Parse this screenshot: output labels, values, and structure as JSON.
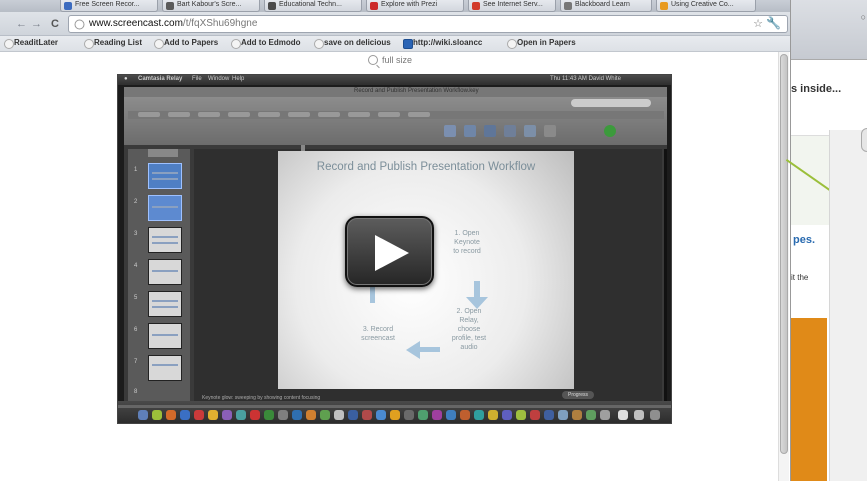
{
  "browser": {
    "tabs": [
      {
        "label": "Free Screen Recor...",
        "color": "#3c6bbf"
      },
      {
        "label": "Bart Kabour's Scre...",
        "color": "#5b5b5b"
      },
      {
        "label": "Educational Techn...",
        "color": "#4b4b4b"
      },
      {
        "label": "Explore with Prezi",
        "color": "#cc2a2a"
      },
      {
        "label": "See Internet Serv...",
        "color": "#d23b2b"
      },
      {
        "label": "Blackboard Learn",
        "color": "#777777"
      },
      {
        "label": "Using Creative Co...",
        "color": "#e89a20"
      }
    ],
    "nav": {
      "back": "←",
      "forward": "→",
      "reload": "C"
    },
    "url_host": "www.screencast.com",
    "url_path": "/t/fqXShu69hgne",
    "bookmarks": [
      {
        "label": "ReaditLater",
        "style": "circle"
      },
      {
        "label": "Reading List",
        "style": "circle"
      },
      {
        "label": "Add to Papers",
        "style": "circle"
      },
      {
        "label": "Add to Edmodo",
        "style": "circle"
      },
      {
        "label": "save on delicious",
        "style": "circle"
      },
      {
        "label": "http://wiki.sloancc",
        "style": "blue"
      },
      {
        "label": "Open in Papers",
        "style": "circle"
      }
    ]
  },
  "page": {
    "full_size_label": "full size"
  },
  "video": {
    "mac_menu": [
      "Camtasia Relay",
      "File",
      "Window",
      "Help"
    ],
    "mac_clock": "Thu 11:43 AM  David White",
    "keynote_title": "Record and Publish Presentation Workflow.key",
    "slide": {
      "title": "Record and Publish Presentation Workflow",
      "step1": "1. Open\nKeynote\nto record",
      "step2": "2. Open\nRelay,\nchoose\nprofile, test\naudio",
      "step3": "3. Record\nscreencast"
    },
    "status_text": "Keynote glow: sweeping by showing content focusing",
    "progress_label": "Progress",
    "slide_numbers": [
      "1",
      "2",
      "3",
      "4",
      "5",
      "6",
      "7",
      "8"
    ]
  },
  "right_window": {
    "text1": "s inside...",
    "text2": "pes.",
    "text3": "it the"
  },
  "colors": {
    "accent_green": "#9bbf3a",
    "accent_orange": "#e08a18",
    "link_blue": "#2a6bb0"
  }
}
